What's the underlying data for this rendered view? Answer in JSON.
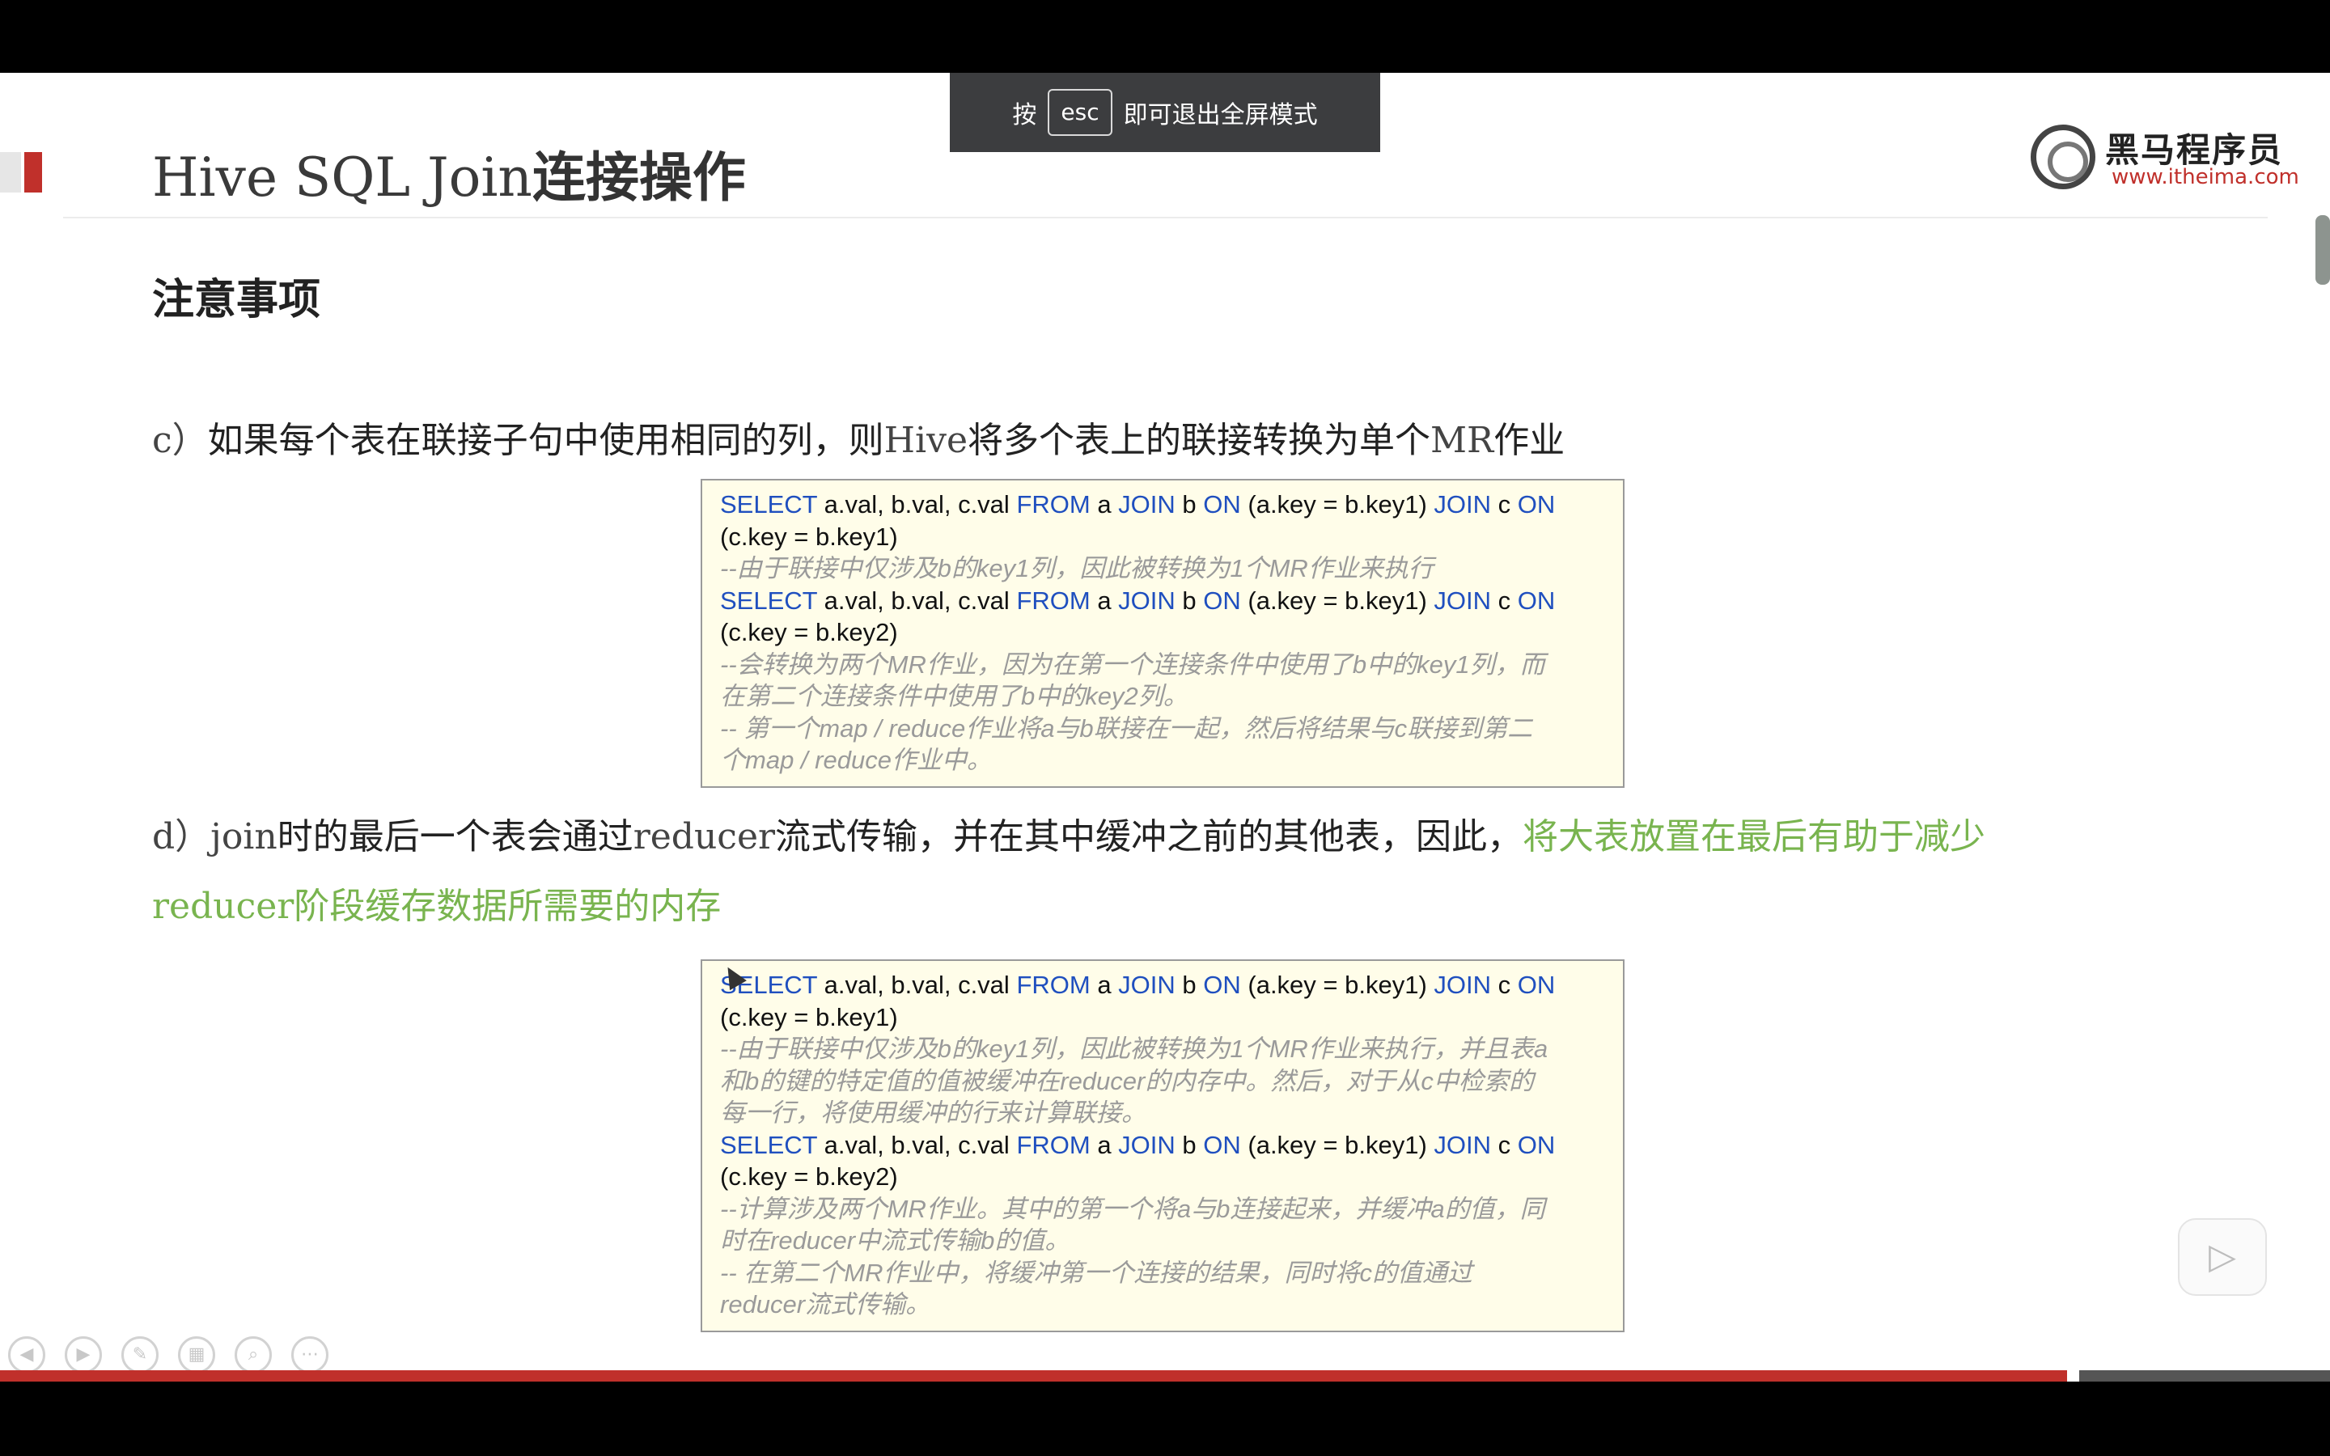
{
  "toast": {
    "prefix": "按",
    "key": "esc",
    "suffix": "即可退出全屏模式"
  },
  "slide": {
    "title_en": "Hive SQL Join",
    "title_cn": "连接操作",
    "logo": {
      "name": "黑马程序员",
      "url": "www.itheima.com"
    },
    "section_heading": "注意事项",
    "point_c": {
      "prefix": "c）",
      "t1": "如果每个表在联接子句中使用相同的列，则",
      "e1": "Hive",
      "t2": "将多个表上的联接转换为单个",
      "e2": "MR",
      "t3": "作业"
    },
    "point_d": {
      "prefix": "d）",
      "e1": "join",
      "t1": "时的最后一个表会通过",
      "e2": "reducer",
      "t2": "流式传输，并在其中缓冲之前的其他表，因此，",
      "g1": "将大表放置在最后有助于减少",
      "ge": "reducer",
      "g2": "阶段缓存数据所需要的内存"
    },
    "code1": {
      "q1_rest1": "(c.key = b.key1)",
      "c1": "--由于联接中仅涉及b的key1列，因此被转换为1个MR作业来执行",
      "q2_rest1": "(c.key = b.key2)",
      "c2a": "--会转换为两个MR作业，因为在第一个连接条件中使用了b中的key1列，而",
      "c2b": "在第二个连接条件中使用了b中的key2列。",
      "c3a": "-- 第一个map / reduce作业将a与b联接在一起，然后将结果与c联接到第二",
      "c3b": "个map / reduce作业中。"
    },
    "code2": {
      "q1_rest1": "(c.key = b.key1)",
      "c1a": "--由于联接中仅涉及b的key1列，因此被转换为1个MR作业来执行，并且表a",
      "c1b": "和b的键的特定值的值被缓冲在reducer的内存中。然后，对于从c中检索的",
      "c1c": "每一行，将使用缓冲的行来计算联接。",
      "q2_rest1": "(c.key = b.key2)",
      "c2a": "--计算涉及两个MR作业。其中的第一个将a与b连接起来，并缓冲a的值，同",
      "c2b": "时在reducer中流式传输b的值。",
      "c3a": "-- 在第二个MR作业中，将缓冲第一个连接的结果，同时将c的值通过",
      "c3b": "reducer流式传输。"
    },
    "sql": {
      "select": "SELECT",
      "cols": " a.val, b.val, c.val ",
      "from": "FROM",
      "a": " a ",
      "join": "JOIN",
      "b": " b ",
      "on": "ON",
      "cond": " (a.key = b.key1) ",
      "c": " c "
    }
  },
  "colors": {
    "accent": "#c0302b",
    "keyword": "#1f4fbf",
    "highlight": "#79b44f",
    "code_bg": "#fffde9"
  },
  "icons": [
    "prev-icon",
    "next-icon",
    "pen-icon",
    "grid-icon",
    "zoom-icon",
    "more-icon",
    "play-icon"
  ]
}
